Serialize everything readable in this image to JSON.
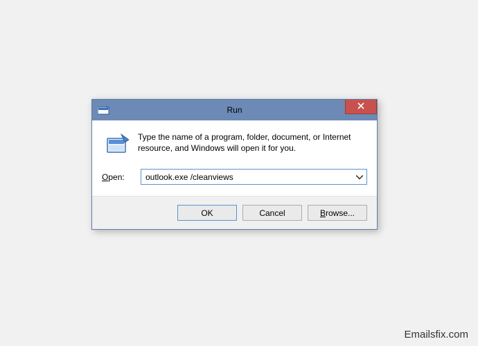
{
  "titlebar": {
    "title": "Run"
  },
  "body": {
    "info_text": "Type the name of a program, folder, document, or Internet resource, and Windows will open it for you.",
    "open_label_prefix": "O",
    "open_label_rest": "pen:",
    "input_value": "outlook.exe  /cleanviews"
  },
  "buttons": {
    "ok": "OK",
    "cancel": "Cancel",
    "browse_prefix": "B",
    "browse_rest": "rowse..."
  },
  "watermark": "Emailsfix.com"
}
